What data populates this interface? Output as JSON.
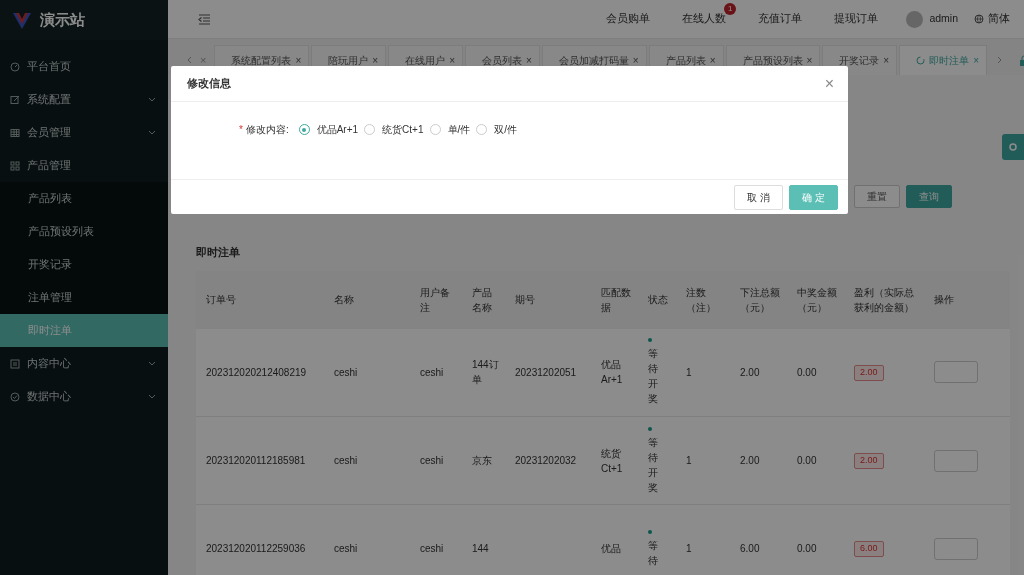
{
  "brand": {
    "title": "演示站"
  },
  "sidebar": {
    "items": [
      {
        "label": "平台首页",
        "kind": "link"
      },
      {
        "label": "系统配置",
        "kind": "group",
        "expanded": false
      },
      {
        "label": "会员管理",
        "kind": "group",
        "expanded": false
      },
      {
        "label": "产品管理",
        "kind": "group",
        "expanded": true,
        "children": [
          {
            "label": "产品列表",
            "selected": false
          },
          {
            "label": "产品预设列表",
            "selected": false
          },
          {
            "label": "开奖记录",
            "selected": false
          },
          {
            "label": "注单管理",
            "selected": false
          },
          {
            "label": "即时注单",
            "selected": true
          }
        ]
      },
      {
        "label": "内容中心",
        "kind": "group",
        "expanded": false
      },
      {
        "label": "数据中心",
        "kind": "group",
        "expanded": false
      }
    ]
  },
  "header": {
    "links": [
      {
        "label": "会员购单"
      },
      {
        "label": "在线人数",
        "badge": "1"
      },
      {
        "label": "充值订单"
      },
      {
        "label": "提现订单"
      }
    ],
    "user": "admin",
    "language": "简体"
  },
  "tabs": {
    "partial_close": "×",
    "items": [
      {
        "label": "系统配置列表",
        "selected": false,
        "close": "×"
      },
      {
        "label": "陪玩用户",
        "selected": false,
        "close": "×"
      },
      {
        "label": "在线用户",
        "selected": false,
        "close": "×"
      },
      {
        "label": "会员列表",
        "selected": false,
        "close": "×"
      },
      {
        "label": "会员加减打码量",
        "selected": false,
        "close": "×"
      },
      {
        "label": "产品列表",
        "selected": false,
        "close": "×"
      },
      {
        "label": "产品预设列表",
        "selected": false,
        "close": "×"
      },
      {
        "label": "开奖记录",
        "selected": false,
        "close": "×"
      },
      {
        "label": "即时注单",
        "selected": true,
        "close": "×"
      }
    ]
  },
  "filter": {
    "buttons": [
      {
        "label": "重置",
        "kind": "default"
      },
      {
        "label": "查询",
        "kind": "primary"
      }
    ]
  },
  "table": {
    "title": "即时注单",
    "columns": [
      "订单号",
      "名称",
      "用户备注",
      "产品名称",
      "期号",
      "匹配数据",
      "状态",
      "注数（注）",
      "下注总额（元）",
      "中奖金额（元）",
      "盈利（实际总获利的金额）",
      "操作"
    ],
    "rows": [
      {
        "order": "202312020212408219",
        "name": "ceshi",
        "note": "ceshi",
        "product": "144订单",
        "period": "20231202051",
        "match": "优品Ar+1",
        "status": "等待开奖",
        "count": "1",
        "bet": "2.00",
        "win": "0.00",
        "profit": "2.00"
      },
      {
        "order": "202312020112185981",
        "name": "ceshi",
        "note": "ceshi",
        "product": "京东",
        "period": "20231202032",
        "match": "统货Ct+1",
        "status": "等待开奖",
        "count": "1",
        "bet": "2.00",
        "win": "0.00",
        "profit": "2.00"
      },
      {
        "order": "202312020112259036",
        "name": "ceshi",
        "note": "ceshi",
        "product": "144",
        "match": "优品",
        "status": "等待",
        "count": "1",
        "bet": "6.00",
        "win": "0.00",
        "profit": "6.00"
      }
    ]
  },
  "modal": {
    "title": "修改信息",
    "close": "×",
    "field": {
      "label": "修改内容:",
      "required_mark": "*",
      "options": [
        {
          "label": "优品Ar+1",
          "selected": true
        },
        {
          "label": "统货Ct+1",
          "selected": false
        },
        {
          "label": "单/件",
          "selected": false
        },
        {
          "label": "双/件",
          "selected": false
        }
      ]
    },
    "buttons": [
      {
        "label": "取 消",
        "kind": "default"
      },
      {
        "label": "确 定",
        "kind": "primary"
      }
    ]
  }
}
